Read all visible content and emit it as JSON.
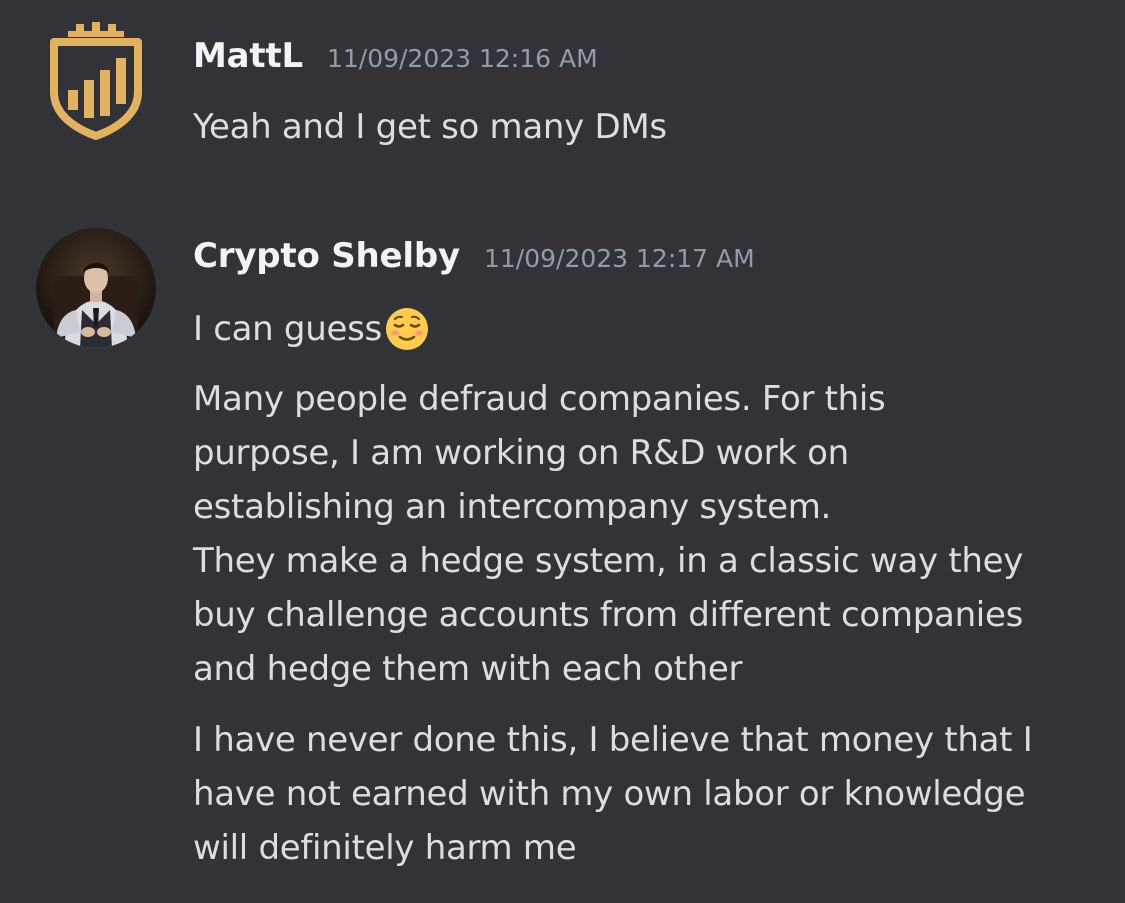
{
  "messages": [
    {
      "username": "MattL",
      "timestamp": "11/09/2023 12:16 AM",
      "avatar_icon": "gold-shield-chart-logo",
      "lines": [
        "Yeah and I get so many DMs"
      ]
    },
    {
      "username": "Crypto Shelby",
      "timestamp": "11/09/2023 12:17 AM",
      "avatar_icon": "profile-photo",
      "first_line": "I can guess",
      "first_line_emoji": "relieved-face-emoji",
      "paragraph_1": [
        "Many people defraud companies. For this",
        "purpose, I am working on R&D work on",
        "establishing an intercompany system.",
        "They make a hedge system, in a classic way they",
        "buy challenge accounts from different companies",
        "and hedge them with each other"
      ],
      "paragraph_2": [
        "I have never done this, I believe that money that I",
        "have not earned with my own labor or knowledge",
        "will definitely harm me"
      ]
    }
  ],
  "colors": {
    "background": "#313338",
    "username": "#f2f3f5",
    "timestamp": "#949ba4",
    "message_text": "#dbdee1",
    "logo_gold": "#e3b25e"
  }
}
